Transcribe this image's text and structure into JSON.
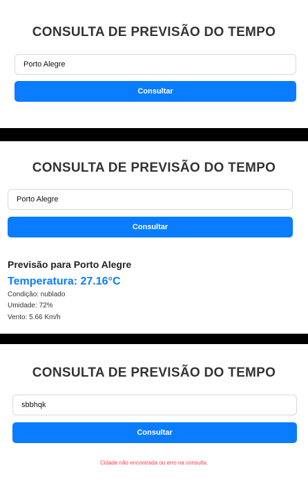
{
  "screens": [
    {
      "title": "CONSULTA DE PREVISÃO DO TEMPO",
      "city_input": {
        "value": "Porto Alegre"
      },
      "button_label": "Consultar"
    },
    {
      "title": "CONSULTA DE PREVISÃO DO TEMPO",
      "city_input": {
        "value": "Porto Alegre"
      },
      "button_label": "Consultar",
      "result": {
        "heading": "Previsão para Porto Alegre",
        "temperature": "Temperatura: 27.16°C",
        "condition": "Condição: nublado",
        "humidity": "Umidade: 72%",
        "wind": "Vento: 5.66 Km/h"
      }
    },
    {
      "title": "CONSULTA DE PREVISÃO DO TEMPO",
      "city_input": {
        "value": "sbbhqk"
      },
      "button_label": "Consultar",
      "error": "Cidade não encontrada ou erro na consulta."
    }
  ],
  "colors": {
    "accent": "#0a7cff",
    "error": "#ff3b3b",
    "title": "#333333",
    "separator": "#000000"
  }
}
